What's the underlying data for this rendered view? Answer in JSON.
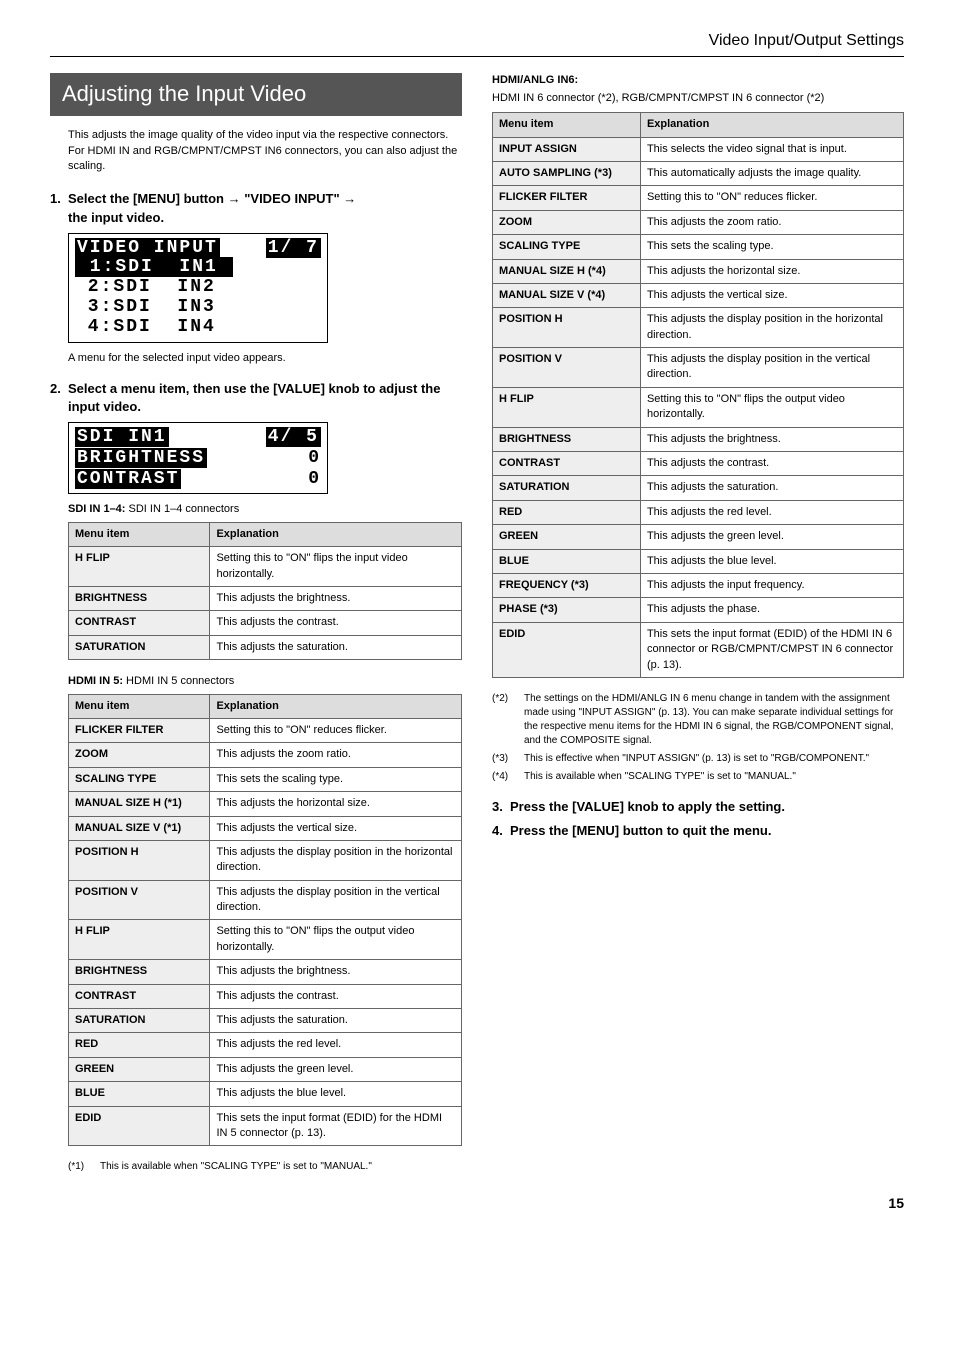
{
  "topbar": "Video Input/Output Settings",
  "heading": "Adjusting the Input Video",
  "intro": "This adjusts the image quality of the video input via the respective connectors. For HDMI IN and RGB/CMPNT/CMPST IN6 connectors, you can also adjust the scaling.",
  "step1": {
    "num": "1.",
    "part1": "Select the [MENU] button",
    "part2": "\"VIDEO INPUT\"",
    "part3": "the input video.",
    "lcd": {
      "title_left": "VIDEO INPUT",
      "title_right": "1/ 7",
      "sel": " 1:SDI  IN1 ",
      "r2": " 2:SDI  IN2",
      "r3": " 3:SDI  IN3",
      "r4": " 4:SDI  IN4"
    },
    "after": "A menu for the selected input video appears."
  },
  "step2": {
    "num": "2.",
    "text": "Select a menu item, then use the [VALUE] knob to adjust the input video.",
    "lcd": {
      "title_left": "SDI  IN1",
      "title_right": "4/ 5",
      "sel": "BRIGHTNESS",
      "v1": "0",
      "r2": "CONTRAST",
      "v2": "0"
    }
  },
  "sdi": {
    "title_bold": "SDI IN 1–4:",
    "title_rest": " SDI IN 1–4 connectors",
    "head_item": "Menu item",
    "head_exp": "Explanation",
    "rows": [
      {
        "k": "H FLIP",
        "v": "Setting this to \"ON\" flips the input video horizontally."
      },
      {
        "k": "BRIGHTNESS",
        "v": "This adjusts the brightness."
      },
      {
        "k": "CONTRAST",
        "v": "This adjusts the contrast."
      },
      {
        "k": "SATURATION",
        "v": "This adjusts the saturation."
      }
    ]
  },
  "hdmi5": {
    "title_bold": "HDMI IN 5:",
    "title_rest": " HDMI IN 5 connectors",
    "head_item": "Menu item",
    "head_exp": "Explanation",
    "rows": [
      {
        "k": "FLICKER FILTER",
        "v": "Setting this to \"ON\" reduces flicker."
      },
      {
        "k": "ZOOM",
        "v": "This adjusts the zoom ratio."
      },
      {
        "k": "SCALING TYPE",
        "v": "This sets the scaling type."
      },
      {
        "k": "MANUAL SIZE H (*1)",
        "v": "This adjusts the horizontal size."
      },
      {
        "k": "MANUAL SIZE V (*1)",
        "v": "This adjusts the vertical size."
      },
      {
        "k": "POSITION H",
        "v": "This adjusts the display position in the horizontal direction."
      },
      {
        "k": "POSITION V",
        "v": "This adjusts the display position in the vertical direction."
      },
      {
        "k": "H FLIP",
        "v": "Setting this to \"ON\" flips the output video horizontally."
      },
      {
        "k": "BRIGHTNESS",
        "v": "This adjusts the brightness."
      },
      {
        "k": "CONTRAST",
        "v": "This adjusts the contrast."
      },
      {
        "k": "SATURATION",
        "v": "This adjusts the saturation."
      },
      {
        "k": "RED",
        "v": "This adjusts the red level."
      },
      {
        "k": "GREEN",
        "v": "This adjusts the green level."
      },
      {
        "k": "BLUE",
        "v": "This adjusts the blue level."
      },
      {
        "k": "EDID",
        "v": "This sets the input format (EDID) for the HDMI IN 5 connector (p. 13)."
      }
    ]
  },
  "fn1": {
    "num": "(*1)",
    "text": "This is available when \"SCALING TYPE\" is set to \"MANUAL.\""
  },
  "hdmi6": {
    "title_bold": "HDMI/ANLG IN6:",
    "subdesc": "HDMI IN 6 connector (*2), RGB/CMPNT/CMPST IN 6 connector (*2)",
    "head_item": "Menu item",
    "head_exp": "Explanation",
    "rows": [
      {
        "k": "INPUT ASSIGN",
        "v": "This selects the video signal that is input."
      },
      {
        "k": "AUTO SAMPLING (*3)",
        "v": "This automatically adjusts the image quality."
      },
      {
        "k": "FLICKER FILTER",
        "v": "Setting this to \"ON\" reduces flicker."
      },
      {
        "k": "ZOOM",
        "v": "This adjusts the zoom ratio."
      },
      {
        "k": "SCALING TYPE",
        "v": "This sets the scaling type."
      },
      {
        "k": "MANUAL SIZE H (*4)",
        "v": "This adjusts the horizontal size."
      },
      {
        "k": "MANUAL SIZE V (*4)",
        "v": "This adjusts the vertical size."
      },
      {
        "k": "POSITION H",
        "v": "This adjusts the display position in the horizontal direction."
      },
      {
        "k": "POSITION V",
        "v": "This adjusts the display position in the vertical direction."
      },
      {
        "k": "H FLIP",
        "v": "Setting this to \"ON\" flips the output video horizontally."
      },
      {
        "k": "BRIGHTNESS",
        "v": "This adjusts the brightness."
      },
      {
        "k": "CONTRAST",
        "v": "This adjusts the contrast."
      },
      {
        "k": "SATURATION",
        "v": "This adjusts the saturation."
      },
      {
        "k": "RED",
        "v": "This adjusts the red level."
      },
      {
        "k": "GREEN",
        "v": "This adjusts the green level."
      },
      {
        "k": "BLUE",
        "v": "This adjusts the blue level."
      },
      {
        "k": "FREQUENCY (*3)",
        "v": "This adjusts the input frequency."
      },
      {
        "k": "PHASE (*3)",
        "v": "This adjusts the phase."
      },
      {
        "k": "EDID",
        "v": "This sets the input format (EDID) of the HDMI IN 6 connector or RGB/CMPNT/CMPST IN 6 connector (p. 13)."
      }
    ]
  },
  "fn2": {
    "num": "(*2)",
    "text": "The settings on the HDMI/ANLG IN 6 menu change in tandem with the assignment made using \"INPUT ASSIGN\" (p. 13). You can make separate individual settings for the respective menu items for the HDMI IN 6 signal, the RGB/COMPONENT signal, and the COMPOSITE signal."
  },
  "fn3": {
    "num": "(*3)",
    "text": "This is effective when \"INPUT ASSIGN\" (p. 13) is set to \"RGB/COMPONENT.\""
  },
  "fn4": {
    "num": "(*4)",
    "text": "This is available when \"SCALING TYPE\" is set to \"MANUAL.\""
  },
  "step3": {
    "num": "3.",
    "text": "Press the [VALUE] knob to apply the setting."
  },
  "step4": {
    "num": "4.",
    "text": "Press the [MENU] button to quit the menu."
  },
  "page": "15"
}
